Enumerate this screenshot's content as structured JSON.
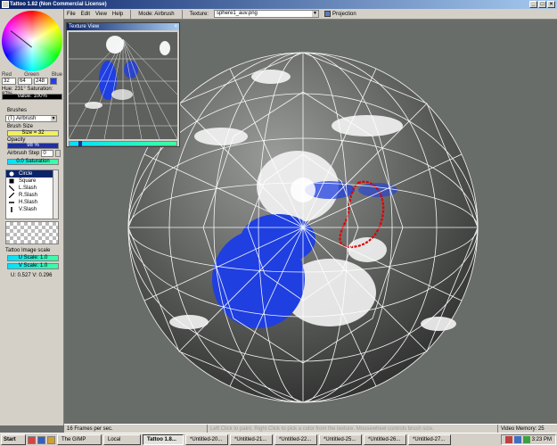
{
  "window": {
    "title": "Tattoo 1.82 (Non Commercial License)",
    "controls": [
      "_",
      "□",
      "×"
    ]
  },
  "menu": {
    "items": [
      "File",
      "Edit",
      "View",
      "Help"
    ],
    "mode": "Mode: Airbrush",
    "texture_label": "Texture:",
    "texture_file": "sphere1_auv.png",
    "projection_label": "Projection"
  },
  "color": {
    "red_label": "Red",
    "green_label": "Green",
    "blue_label": "Blue",
    "red": "32",
    "green": "64",
    "blue": "248",
    "hue_sat": "Hue: 231°  Saturation: 87%",
    "value": "Value: 100%",
    "swatch": "#2040f8"
  },
  "brushes": {
    "label": "Brushes",
    "selected": "(T) Airbrush",
    "size_label": "Brush Size",
    "size_value": "Size = 32",
    "opacity_label": "Opacity",
    "opacity_value": "98 %",
    "step_label": "Airbrush Step",
    "step_value": "0",
    "step_bar": "0.0 Saturation",
    "shapes": [
      {
        "label": "Circle",
        "icon": "circle-icon"
      },
      {
        "label": "Square",
        "icon": "square-icon"
      },
      {
        "label": "L.Slash",
        "icon": "left-slash-icon"
      },
      {
        "label": "R.Slash",
        "icon": "right-slash-icon"
      },
      {
        "label": "H.Slash",
        "icon": "horizontal-slash-icon"
      },
      {
        "label": "V.Slash",
        "icon": "vertical-slash-icon"
      }
    ]
  },
  "image_scale": {
    "label": "Tattoo Image scale",
    "u": "U Scale: 1.0",
    "v": "V Scale: 1.0",
    "uv": "U: 0.527  V: 0.296"
  },
  "texture_view": {
    "title": "Texture View",
    "close": "×"
  },
  "status": {
    "fps": "16 Frames per sec.",
    "hint": "Left Click to paint. Right Click to pick a color from the texture. Mousewheel controls brush size.",
    "memory": "Video Memory: 25 Meg."
  },
  "taskbar": {
    "start": "Start",
    "tasks": [
      "The GIMP",
      "Local",
      "Tattoo 1.8...",
      "*Untitled-20...",
      "*Untitled-21...",
      "*Untitled-22...",
      "*Untitled-25...",
      "*Untitled-26...",
      "*Untitled-27..."
    ],
    "active_index": 2,
    "clock": "3:23 PM"
  },
  "colors": {
    "paint_blue": "#1f3fe0",
    "selection_red": "#dd0000",
    "wire": "#ffffff"
  }
}
